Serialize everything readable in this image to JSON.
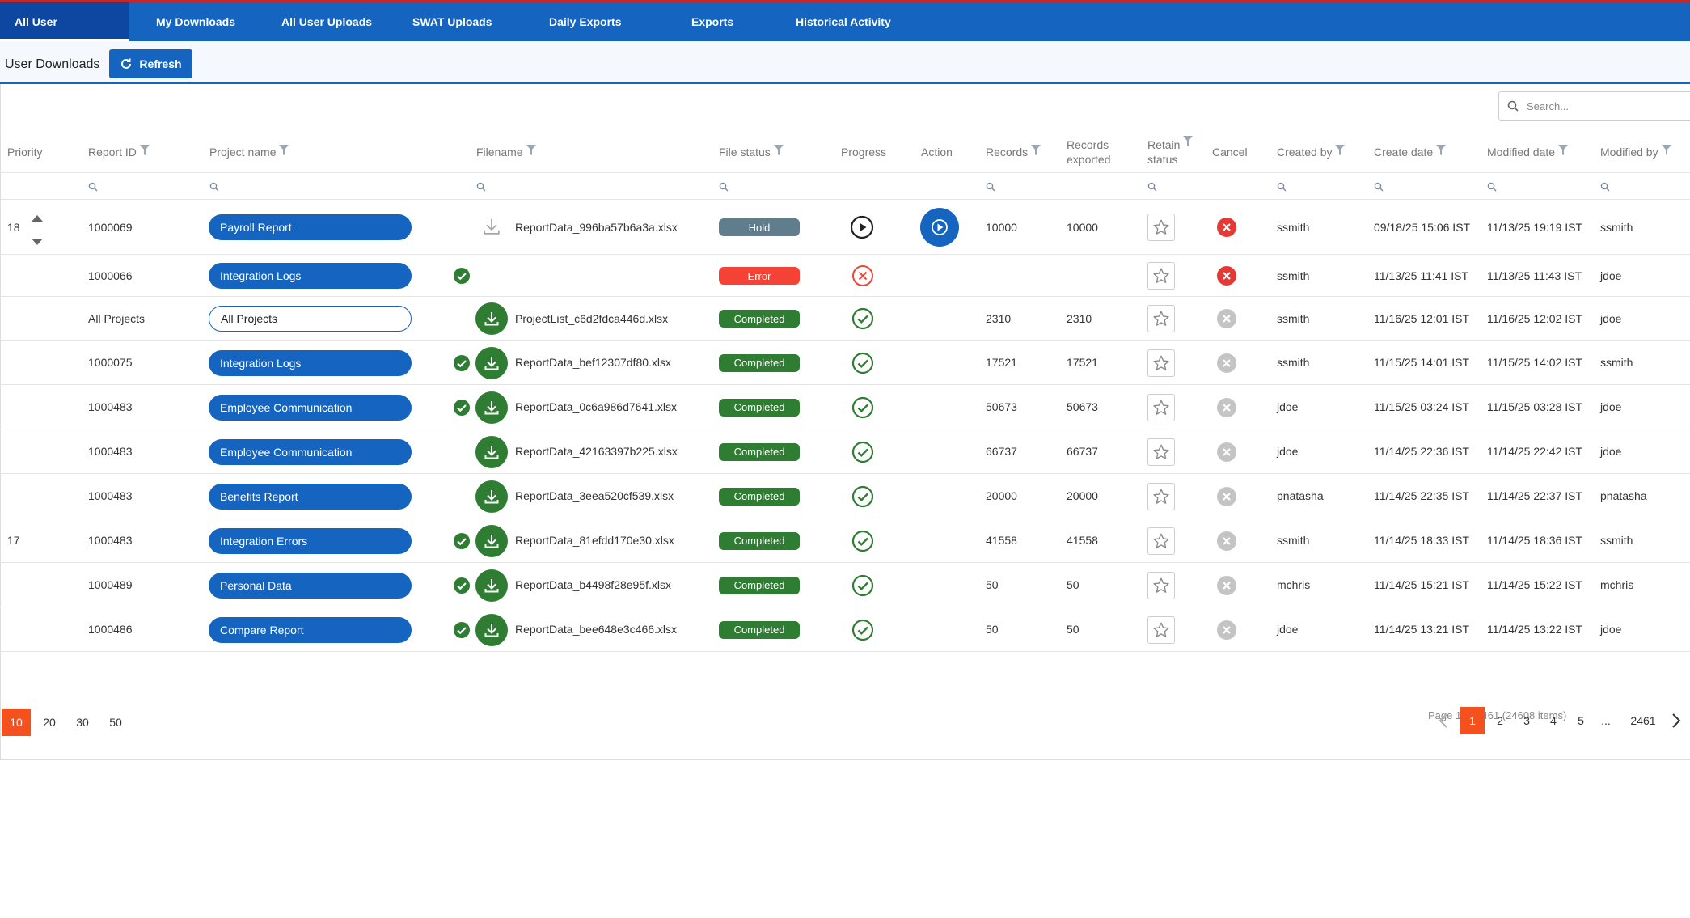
{
  "tabs": [
    "All User Downloads",
    "My Downloads",
    "All User Uploads",
    "SWAT Uploads",
    "Daily Exports",
    "Exports",
    "Historical Activity"
  ],
  "page_title": "User Downloads",
  "refresh_label": "Refresh",
  "search_placeholder": "Search...",
  "columns": {
    "priority": "Priority",
    "report_id": "Report ID",
    "project_name": "Project name",
    "filename": "Filename",
    "file_status": "File status",
    "progress": "Progress",
    "action": "Action",
    "records": "Records",
    "records_exported_1": "Records",
    "records_exported_2": "exported",
    "retain_1": "Retain",
    "retain_2": "status",
    "cancel": "Cancel",
    "created_by": "Created by",
    "create_date": "Create date",
    "modified_date": "Modified date",
    "modified_by": "Modified by"
  },
  "rows": [
    {
      "priority": "18",
      "report_id": "1000069",
      "project": "Payroll Report",
      "project_style": "filled",
      "check": false,
      "download": "pending",
      "filename": "ReportData_996ba57b6a3a.xlsx",
      "status": "Hold",
      "progress": "play",
      "action": true,
      "records": "10000",
      "exported": "10000",
      "cancel": "active",
      "created_by": "ssmith",
      "create_date": "09/18/25 15:06 IST",
      "modified_date": "11/13/25 19:19 IST",
      "modified_by": "ssmith"
    },
    {
      "priority": "",
      "report_id": "1000066",
      "project": "Integration Logs",
      "project_style": "filled",
      "check": true,
      "download": "none",
      "filename": "",
      "status": "Error",
      "progress": "error",
      "action": false,
      "records": "",
      "exported": "",
      "cancel": "active",
      "created_by": "ssmith",
      "create_date": "11/13/25 11:41 IST",
      "modified_date": "11/13/25 11:43 IST",
      "modified_by": "jdoe"
    },
    {
      "priority": "",
      "report_id": "All Projects",
      "project": "All Projects",
      "project_style": "outline",
      "check": false,
      "download": "ready",
      "filename": "ProjectList_c6d2fdca446d.xlsx",
      "status": "Completed",
      "progress": "done",
      "action": false,
      "records": "2310",
      "exported": "2310",
      "cancel": "disabled",
      "created_by": "ssmith",
      "create_date": "11/16/25 12:01 IST",
      "modified_date": "11/16/25 12:02 IST",
      "modified_by": "jdoe"
    },
    {
      "priority": "",
      "report_id": "1000075",
      "project": "Integration Logs",
      "project_style": "filled",
      "check": true,
      "download": "ready",
      "filename": "ReportData_bef12307df80.xlsx",
      "status": "Completed",
      "progress": "done",
      "action": false,
      "records": "17521",
      "exported": "17521",
      "cancel": "disabled",
      "created_by": "ssmith",
      "create_date": "11/15/25 14:01 IST",
      "modified_date": "11/15/25 14:02 IST",
      "modified_by": "ssmith"
    },
    {
      "priority": "",
      "report_id": "1000483",
      "project": "Employee Communication",
      "project_style": "filled",
      "check": true,
      "download": "ready",
      "filename": "ReportData_0c6a986d7641.xlsx",
      "status": "Completed",
      "progress": "done",
      "action": false,
      "records": "50673",
      "exported": "50673",
      "cancel": "disabled",
      "created_by": "jdoe",
      "create_date": "11/15/25 03:24 IST",
      "modified_date": "11/15/25 03:28 IST",
      "modified_by": "jdoe"
    },
    {
      "priority": "",
      "report_id": "1000483",
      "project": "Employee Communication",
      "project_style": "filled",
      "check": false,
      "download": "ready",
      "filename": "ReportData_42163397b225.xlsx",
      "status": "Completed",
      "progress": "done",
      "action": false,
      "records": "66737",
      "exported": "66737",
      "cancel": "disabled",
      "created_by": "jdoe",
      "create_date": "11/14/25 22:36 IST",
      "modified_date": "11/14/25 22:42 IST",
      "modified_by": "jdoe"
    },
    {
      "priority": "",
      "report_id": "1000483",
      "project": "Benefits Report",
      "project_style": "filled",
      "check": false,
      "download": "ready",
      "filename": "ReportData_3eea520cf539.xlsx",
      "status": "Completed",
      "progress": "done",
      "action": false,
      "records": "20000",
      "exported": "20000",
      "cancel": "disabled",
      "created_by": "pnatasha",
      "create_date": "11/14/25 22:35 IST",
      "modified_date": "11/14/25 22:37 IST",
      "modified_by": "pnatasha"
    },
    {
      "priority": "17",
      "report_id": "1000483",
      "project": "Integration Errors",
      "project_style": "filled",
      "check": true,
      "download": "ready",
      "filename": "ReportData_81efdd170e30.xlsx",
      "status": "Completed",
      "progress": "done",
      "action": false,
      "records": "41558",
      "exported": "41558",
      "cancel": "disabled",
      "created_by": "ssmith",
      "create_date": "11/14/25 18:33 IST",
      "modified_date": "11/14/25 18:36 IST",
      "modified_by": "ssmith"
    },
    {
      "priority": "",
      "report_id": "1000489",
      "project": "Personal Data",
      "project_style": "filled",
      "check": true,
      "download": "ready",
      "filename": "ReportData_b4498f28e95f.xlsx",
      "status": "Completed",
      "progress": "done",
      "action": false,
      "records": "50",
      "exported": "50",
      "cancel": "disabled",
      "created_by": "mchris",
      "create_date": "11/14/25 15:21 IST",
      "modified_date": "11/14/25 15:22 IST",
      "modified_by": "mchris"
    },
    {
      "priority": "",
      "report_id": "1000486",
      "project": "Compare Report",
      "project_style": "filled",
      "check": true,
      "download": "ready",
      "filename": "ReportData_bee648e3c466.xlsx",
      "status": "Completed",
      "progress": "done",
      "action": false,
      "records": "50",
      "exported": "50",
      "cancel": "disabled",
      "created_by": "jdoe",
      "create_date": "11/14/25 13:21 IST",
      "modified_date": "11/14/25 13:22 IST",
      "modified_by": "jdoe"
    }
  ],
  "page_sizes": [
    "10",
    "20",
    "30",
    "50"
  ],
  "page_size_selected": "10",
  "page_info": "Page 1 of 2461 (24608 items)",
  "pages": [
    "1",
    "2",
    "3",
    "4",
    "5",
    "...",
    "2461"
  ],
  "current_page": "1",
  "colors": {
    "brand": "#1565c0",
    "completed": "#2e7d32",
    "error": "#f44336",
    "hold": "#5f7d8c",
    "pager_active": "#f4511e"
  }
}
